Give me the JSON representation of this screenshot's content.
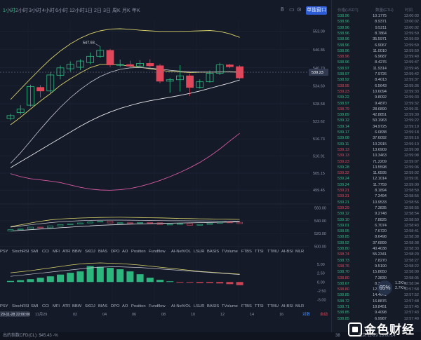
{
  "timeframes": [
    "1小时",
    "2小时",
    "3小时",
    "4小时",
    "6小时",
    "12小时",
    "1日",
    "2日",
    "3日",
    "周K",
    "月K",
    "年K"
  ],
  "active_timeframe": "1小时",
  "toolbar": {
    "settings_label": "8",
    "single_column_label": "单独窗口"
  },
  "colors": {
    "up": "#2dbf83",
    "down": "#e0475a",
    "ma_short": "#d9d36a",
    "ma_mid": "#c8c8d4",
    "ma_long": "#e8e8ee",
    "indicator": "#d65aa2",
    "background": "#151a28"
  },
  "price_panel": {
    "max_label": "547.93",
    "current_price": "539.23",
    "y_ticks": [
      "553.09",
      "546.86",
      "540.70",
      "534.60",
      "528.58",
      "522.62",
      "516.73",
      "510.91",
      "505.15",
      "499.45"
    ],
    "candles": [
      {
        "o": 523.6,
        "c": 524.6,
        "h": 525.2,
        "l": 523.0
      },
      {
        "o": 525.6,
        "c": 526.8,
        "h": 528.1,
        "l": 524.9
      },
      {
        "o": 528.1,
        "c": 534.4,
        "h": 535.0,
        "l": 527.6
      },
      {
        "o": 534.1,
        "c": 532.9,
        "h": 534.9,
        "l": 530.7
      },
      {
        "o": 532.9,
        "c": 538.3,
        "h": 539.3,
        "l": 532.0
      },
      {
        "o": 538.2,
        "c": 540.7,
        "h": 541.5,
        "l": 536.8
      },
      {
        "o": 540.4,
        "c": 541.9,
        "h": 542.9,
        "l": 539.4
      },
      {
        "o": 540.9,
        "c": 543.0,
        "h": 543.6,
        "l": 539.9
      },
      {
        "o": 542.5,
        "c": 544.6,
        "h": 545.9,
        "l": 541.9
      },
      {
        "o": 544.6,
        "c": 546.6,
        "h": 547.9,
        "l": 544.0
      },
      {
        "o": 546.6,
        "c": 541.7,
        "h": 547.1,
        "l": 541.0
      },
      {
        "o": 541.7,
        "c": 541.8,
        "h": 543.5,
        "l": 541.0
      },
      {
        "o": 541.8,
        "c": 541.3,
        "h": 543.1,
        "l": 540.6
      },
      {
        "o": 541.3,
        "c": 542.2,
        "h": 543.3,
        "l": 540.7
      },
      {
        "o": 542.2,
        "c": 541.4,
        "h": 543.6,
        "l": 540.9
      },
      {
        "o": 541.4,
        "c": 536.2,
        "h": 542.0,
        "l": 535.5
      },
      {
        "o": 536.2,
        "c": 536.7,
        "h": 537.3,
        "l": 532.3
      },
      {
        "o": 536.7,
        "c": 538.0,
        "h": 541.6,
        "l": 532.7
      },
      {
        "o": 538.0,
        "c": 534.1,
        "h": 538.8,
        "l": 531.2
      },
      {
        "o": 534.1,
        "c": 536.0,
        "h": 536.8,
        "l": 533.7
      },
      {
        "o": 536.0,
        "c": 538.9,
        "h": 539.8,
        "l": 535.7
      },
      {
        "o": 538.9,
        "c": 541.7,
        "h": 542.4,
        "l": 538.3
      },
      {
        "o": 541.7,
        "c": 541.1,
        "h": 542.0,
        "l": 540.6
      },
      {
        "o": 541.1,
        "c": 537.3,
        "h": 541.6,
        "l": 536.9
      }
    ],
    "ma_short": [
      521.5,
      524.0,
      526.8,
      529.5,
      532.0,
      534.8,
      537.0,
      539.0,
      540.8,
      541.8,
      541.9,
      541.7,
      541.3,
      540.9,
      540.4,
      539.9,
      539.5,
      539.3,
      539.1,
      539.2,
      539.2,
      539.3,
      539.4,
      539.3
    ],
    "ma_mid": [
      508.5,
      512.0,
      516.0,
      520.0,
      523.8,
      527.4,
      530.6,
      533.4,
      535.8,
      537.8,
      539.2,
      540.2,
      540.7,
      540.8,
      540.6,
      540.3,
      539.9,
      539.6,
      539.4,
      539.3,
      539.3,
      539.3,
      539.3,
      539.2
    ],
    "ma_upper": [
      530.0,
      533.5,
      537.0,
      540.4,
      543.6,
      546.4,
      548.8,
      550.7,
      552.2,
      553.2,
      553.8,
      553.9,
      553.7,
      553.4,
      553.2,
      553.0,
      553.0,
      553.0,
      553.1,
      553.2,
      553.3,
      553.0,
      552.2,
      551.0
    ],
    "ma_long": [
      507.0,
      509.0,
      511.0,
      513.0,
      515.0,
      517.0,
      519.0,
      521.0,
      522.8,
      524.4,
      525.8,
      527.0,
      528.0,
      528.9,
      529.6,
      530.2,
      530.8,
      531.4,
      532.1,
      532.9,
      533.8,
      534.7,
      535.6,
      536.6
    ],
    "indicator_line": [
      505.0,
      504.0,
      503.3,
      502.9,
      502.5,
      502.0,
      501.2,
      500.4,
      499.8,
      499.5,
      499.4,
      499.6,
      500.0,
      500.7,
      501.6,
      502.7,
      504.0,
      505.4,
      507.0,
      508.8,
      510.9,
      513.3,
      516.0,
      518.6
    ]
  },
  "sub_panel": {
    "y_ticks": [
      "560.00",
      "540.00",
      "520.00",
      "500.00"
    ],
    "ma_short": [
      530.8,
      533.5,
      536.5,
      539.2,
      541.3,
      542.7,
      543.6,
      544.2,
      544.7,
      545.1,
      545.3,
      545.4,
      545.2,
      545.0,
      544.7,
      544.4,
      544.0,
      543.6,
      543.3,
      543.0,
      542.8,
      542.6,
      542.4,
      542.0
    ],
    "ma_mid": [
      530.0,
      531.8,
      533.6,
      535.4,
      537.0,
      538.3,
      539.3,
      540.0,
      540.5,
      540.8,
      540.9,
      540.9,
      540.8,
      540.6,
      540.4,
      540.2,
      540.0,
      539.9,
      539.8,
      539.7,
      539.6,
      539.5,
      539.4,
      539.3
    ],
    "ma_long": [
      524.0,
      525.0,
      526.0,
      527.0,
      528.0,
      529.0,
      530.0,
      531.0,
      532.0,
      532.8,
      533.5,
      534.1,
      534.6,
      535.0,
      535.4,
      535.8,
      536.1,
      536.4,
      536.7,
      537.0,
      537.3,
      537.6,
      537.9,
      538.2
    ],
    "candles": [
      {
        "o": 524.0,
        "c": 526.0
      },
      {
        "o": 526.0,
        "c": 527.0
      },
      {
        "o": 527.0,
        "c": 530.0
      },
      {
        "o": 530.0,
        "c": 529.0
      },
      {
        "o": 529.0,
        "c": 532.0
      },
      {
        "o": 532.0,
        "c": 534.0
      },
      {
        "o": 534.0,
        "c": 535.0
      },
      {
        "o": 535.0,
        "c": 536.5
      },
      {
        "o": 536.5,
        "c": 538.0
      },
      {
        "o": 538.0,
        "c": 539.0
      },
      {
        "o": 539.0,
        "c": 536.5
      },
      {
        "o": 536.5,
        "c": 536.8
      },
      {
        "o": 536.8,
        "c": 536.5
      },
      {
        "o": 536.5,
        "c": 537.3
      },
      {
        "o": 537.3,
        "c": 536.8
      },
      {
        "o": 536.8,
        "c": 534.0
      },
      {
        "o": 534.0,
        "c": 534.5
      },
      {
        "o": 534.5,
        "c": 535.4
      },
      {
        "o": 535.4,
        "c": 533.0
      },
      {
        "o": 533.0,
        "c": 534.2
      },
      {
        "o": 534.2,
        "c": 536.0
      },
      {
        "o": 536.0,
        "c": 537.8
      },
      {
        "o": 537.8,
        "c": 537.5
      },
      {
        "o": 537.5,
        "c": 535.5
      }
    ]
  },
  "indicator_tabs": [
    "PSY",
    "StochRSI",
    "SMI",
    "CCI",
    "MFI",
    "ATR",
    "BBW",
    "SKDJ",
    "BIAS",
    "DPO",
    "AO",
    "Position",
    "Fundflow",
    "AI-NetVOL",
    "LSUR",
    "BASIS",
    "TVolume",
    "FTBS",
    "TTSI",
    "TTMU",
    "AI-BSI",
    "MLR"
  ],
  "hist_panel": {
    "y_ticks": [
      "5.00",
      "2.50",
      "0.00",
      "-2.50",
      "-5.00"
    ],
    "bars": [
      0.3,
      0.5,
      0.8,
      1.2,
      1.6,
      2.1,
      2.6,
      3.0,
      4.5,
      4.3,
      4.0,
      3.6,
      3.0,
      2.2,
      1.2,
      0.6,
      0.2,
      -0.1,
      -0.2,
      -0.3,
      -0.3,
      -0.4,
      -0.6,
      -0.9
    ],
    "line_a": [
      2.6,
      2.9,
      3.2,
      3.6,
      4.0,
      4.4,
      4.8,
      5.1,
      5.3,
      5.4,
      5.3,
      5.2,
      5.0,
      4.8,
      4.5,
      4.2,
      3.9,
      3.6,
      3.3,
      3.0,
      2.8,
      2.6,
      2.4,
      2.2
    ],
    "line_b": [
      1.6,
      1.9,
      2.2,
      2.5,
      2.8,
      3.1,
      3.4,
      3.7,
      4.0,
      4.2,
      4.3,
      4.3,
      4.2,
      4.1,
      3.9,
      3.7,
      3.5,
      3.3,
      3.1,
      2.9,
      2.7,
      2.5,
      2.3,
      2.1
    ]
  },
  "time_axis": {
    "highlight": "20-11-28 22:00:00",
    "month_label": "11月29",
    "ticks": [
      "02",
      "04",
      "06",
      "08",
      "10",
      "12",
      "14",
      "16"
    ],
    "right_labels": [
      "对数",
      "自动"
    ]
  },
  "status": {
    "left_text": "出的指数CFD(CL): $45.43 -%",
    "right_text": "北京 11-29 13:00:14",
    "battery": "38"
  },
  "percent_badge": "65%",
  "speed": [
    "1.2K/s",
    "2.7K/s"
  ],
  "watermark": "金色财经",
  "trades": {
    "headers": [
      "价格(USDT)",
      "数量(ETH)",
      "时间"
    ],
    "rows": [
      {
        "price": "538.96",
        "amount": "10.1775",
        "time": "13:00:03",
        "side": "up"
      },
      {
        "price": "538.96",
        "amount": "8.9371",
        "time": "13:00:02",
        "side": "up"
      },
      {
        "price": "538.96",
        "amount": "9.5211",
        "time": "13:00:02",
        "side": "up"
      },
      {
        "price": "538.96",
        "amount": "8.7864",
        "time": "12:59:59",
        "side": "up"
      },
      {
        "price": "538.96",
        "amount": "35.5971",
        "time": "12:59:59",
        "side": "up"
      },
      {
        "price": "538.96",
        "amount": "6.9067",
        "time": "12:59:59",
        "side": "up"
      },
      {
        "price": "538.96",
        "amount": "11.0010",
        "time": "12:59:50",
        "side": "up"
      },
      {
        "price": "538.96",
        "amount": "6.9687",
        "time": "12:59:49",
        "side": "dn"
      },
      {
        "price": "538.96",
        "amount": "8.4276",
        "time": "12:59:47",
        "side": "up"
      },
      {
        "price": "538.97",
        "amount": "11.9314",
        "time": "12:59:45",
        "side": "up"
      },
      {
        "price": "538.97",
        "amount": "7.9726",
        "time": "12:59:42",
        "side": "up"
      },
      {
        "price": "538.92",
        "amount": "8.4013",
        "time": "12:59:37",
        "side": "up"
      },
      {
        "price": "538.95",
        "amount": "6.5643",
        "time": "12:59:36",
        "side": "dn"
      },
      {
        "price": "539.23",
        "amount": "10.6094",
        "time": "12:59:33",
        "side": "dn"
      },
      {
        "price": "539.22",
        "amount": "9.8092",
        "time": "12:59:33",
        "side": "up"
      },
      {
        "price": "538.97",
        "amount": "9.4870",
        "time": "12:59:32",
        "side": "up"
      },
      {
        "price": "538.79",
        "amount": "28.6890",
        "time": "12:59:31",
        "side": "dn"
      },
      {
        "price": "538.89",
        "amount": "42.8851",
        "time": "12:59:30",
        "side": "up"
      },
      {
        "price": "539.12",
        "amount": "50.1963",
        "time": "12:59:22",
        "side": "up"
      },
      {
        "price": "539.14",
        "amount": "34.9725",
        "time": "12:59:19",
        "side": "up"
      },
      {
        "price": "539.17",
        "amount": "6.0838",
        "time": "12:59:18",
        "side": "up"
      },
      {
        "price": "539.08",
        "amount": "37.6092",
        "time": "12:59:16",
        "side": "up"
      },
      {
        "price": "539.11",
        "amount": "10.2915",
        "time": "12:59:10",
        "side": "up"
      },
      {
        "price": "539.13",
        "amount": "13.6909",
        "time": "12:59:08",
        "side": "dn"
      },
      {
        "price": "539.13",
        "amount": "10.3463",
        "time": "12:59:08",
        "side": "dn"
      },
      {
        "price": "539.23",
        "amount": "71.2209",
        "time": "12:59:07",
        "side": "dn"
      },
      {
        "price": "539.28",
        "amount": "13.5598",
        "time": "12:59:06",
        "side": "up"
      },
      {
        "price": "539.32",
        "amount": "11.6595",
        "time": "12:59:02",
        "side": "dn"
      },
      {
        "price": "539.24",
        "amount": "12.1014",
        "time": "12:59:01",
        "side": "up"
      },
      {
        "price": "539.24",
        "amount": "11.7759",
        "time": "12:59:00",
        "side": "up"
      },
      {
        "price": "539.21",
        "amount": "8.1894",
        "time": "12:58:59",
        "side": "dn"
      },
      {
        "price": "539.31",
        "amount": "7.3494",
        "time": "12:58:56",
        "side": "dn"
      },
      {
        "price": "539.21",
        "amount": "10.9533",
        "time": "12:58:56",
        "side": "up"
      },
      {
        "price": "539.29",
        "amount": "7.3835",
        "time": "12:58:55",
        "side": "dn"
      },
      {
        "price": "539.12",
        "amount": "9.2748",
        "time": "12:58:54",
        "side": "up"
      },
      {
        "price": "539.10",
        "amount": "7.8825",
        "time": "12:58:50",
        "side": "up"
      },
      {
        "price": "539.01",
        "amount": "6.7074",
        "time": "12:58:43",
        "side": "up"
      },
      {
        "price": "538.95",
        "amount": "7.6720",
        "time": "12:58:41",
        "side": "up"
      },
      {
        "price": "538.85",
        "amount": "8.6498",
        "time": "12:58:38",
        "side": "up"
      },
      {
        "price": "538.92",
        "amount": "37.6899",
        "time": "12:58:38",
        "side": "up"
      },
      {
        "price": "538.80",
        "amount": "40.4038",
        "time": "12:58:33",
        "side": "up"
      },
      {
        "price": "538.74",
        "amount": "55.2341",
        "time": "12:58:29",
        "side": "dn"
      },
      {
        "price": "538.73",
        "amount": "7.8270",
        "time": "12:58:27",
        "side": "up"
      },
      {
        "price": "538.76",
        "amount": "9.5190",
        "time": "12:58:22",
        "side": "dn"
      },
      {
        "price": "538.70",
        "amount": "15.8650",
        "time": "12:58:09",
        "side": "up"
      },
      {
        "price": "538.80",
        "amount": "7.3830",
        "time": "12:58:05",
        "side": "dn"
      },
      {
        "price": "538.67",
        "amount": "8.3690",
        "time": "12:58:04",
        "side": "up"
      },
      {
        "price": "538.80",
        "amount": "12.5533",
        "time": "12:57:58",
        "side": "dn"
      },
      {
        "price": "538.85",
        "amount": "14.4641",
        "time": "12:57:52",
        "side": "up"
      },
      {
        "price": "538.72",
        "amount": "16.8876",
        "time": "12:57:48",
        "side": "up"
      },
      {
        "price": "538.71",
        "amount": "18.8451",
        "time": "12:57:45",
        "side": "up"
      },
      {
        "price": "538.85",
        "amount": "9.4098",
        "time": "12:57:43",
        "side": "up"
      },
      {
        "price": "538.85",
        "amount": "6.9987",
        "time": "12:57:40",
        "side": "up"
      }
    ]
  }
}
